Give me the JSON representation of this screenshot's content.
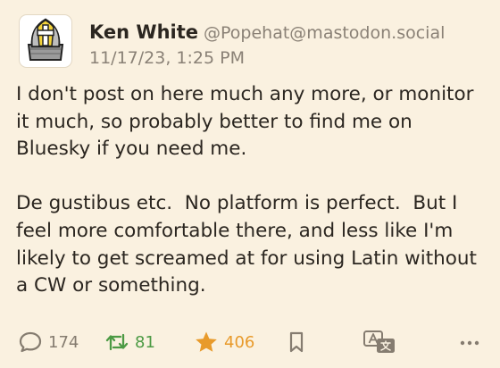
{
  "post": {
    "author": {
      "display_name": "Ken White",
      "handle": "@Popehat@mastodon.social"
    },
    "timestamp": "11/17/23, 1:25 PM",
    "content": {
      "paragraphs": [
        "I don't post on here much any more, or monitor it much, so probably better to find me on Bluesky if you need me.",
        "De gustibus etc.  No platform is perfect.  But I feel more comfortable there, and less like I'm likely to get screamed at for using Latin without a CW or something."
      ]
    },
    "stats": {
      "replies": "174",
      "boosts": "81",
      "favourites": "406"
    },
    "icons": {
      "avatar": "mitre-with-cross-icon",
      "reply": "speech-bubble-icon",
      "boost": "boost-arrows-icon",
      "favourite": "star-icon",
      "bookmark": "bookmark-icon",
      "translate": "translate-icon",
      "more": "ellipsis-icon"
    },
    "colors": {
      "background": "#faf1e0",
      "boost": "#4c9a44",
      "favourite": "#e89a2b",
      "muted": "#857c70"
    }
  }
}
